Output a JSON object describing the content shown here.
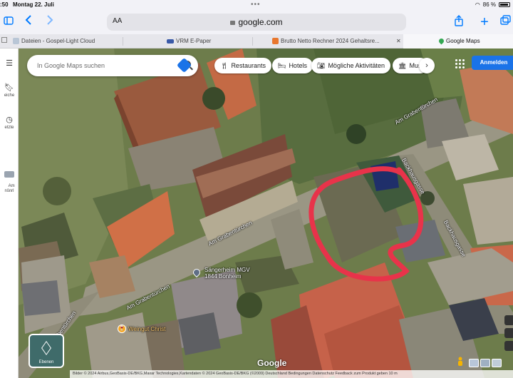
{
  "status_bar": {
    "time": ":50",
    "date": "Montag 22. Juli",
    "battery": "86 %"
  },
  "toolbar": {
    "reader_label": "AA",
    "url": "google.com"
  },
  "tabs": [
    {
      "label": "Dateien - Gospel-Light Cloud",
      "icon": "cloud-icon"
    },
    {
      "label": "VRM E-Paper",
      "icon": "vrm-icon"
    },
    {
      "label": "Brutto Netto Rechner 2024 Gehaltsre...",
      "icon": "calculator-icon"
    },
    {
      "label": "Google Maps",
      "icon": "maps-pin-icon"
    }
  ],
  "sidebar": {
    "items": [
      {
        "label": "",
        "icon": "menu-icon"
      },
      {
        "label": "eiche",
        "icon": "bookmark-icon"
      },
      {
        "label": "etzte",
        "icon": "history-icon"
      },
      {
        "label": "Am\nnšnrl",
        "icon": "thumbnail-icon"
      }
    ]
  },
  "search": {
    "placeholder": "In Google Maps suchen"
  },
  "chips": [
    {
      "label": "Restaurants",
      "icon": "fork-knife-icon"
    },
    {
      "label": "Hotels",
      "icon": "bed-icon"
    },
    {
      "label": "Mögliche Aktivitäten",
      "icon": "camera-icon"
    },
    {
      "label": "Mus",
      "icon": "museum-icon"
    }
  ],
  "signin_label": "Anmelden",
  "layers_label": "Ebenen",
  "map": {
    "places": [
      {
        "label": "Sängerheim MGV\n1844 Bonheim",
        "icon": "place-pin-icon"
      },
      {
        "label": "Weingut Christ",
        "icon": "wine-pin-icon"
      }
    ],
    "streets": [
      {
        "label": "Am Grabentürchen"
      },
      {
        "label": "Am Grabentürchen"
      },
      {
        "label": "Am Grabentürchen"
      },
      {
        "label": "Am Grabentürchen"
      },
      {
        "label": "Backhausgasse"
      },
      {
        "label": "Backhausgasse"
      }
    ],
    "logo": "Google",
    "attribution": "Bilder © 2024 Airbus,GeoBasis-DE/BKG,Maxar Technologies,Kartendaten © 2024 GeoBasis-DE/BKG (©2009)   Deutschland   Bedingungen   Datenschutz   Feedback zum Produkt geben   10 m"
  },
  "colors": {
    "accent": "#007aff",
    "signin": "#1a73e8",
    "annotation": "#e8334a"
  }
}
